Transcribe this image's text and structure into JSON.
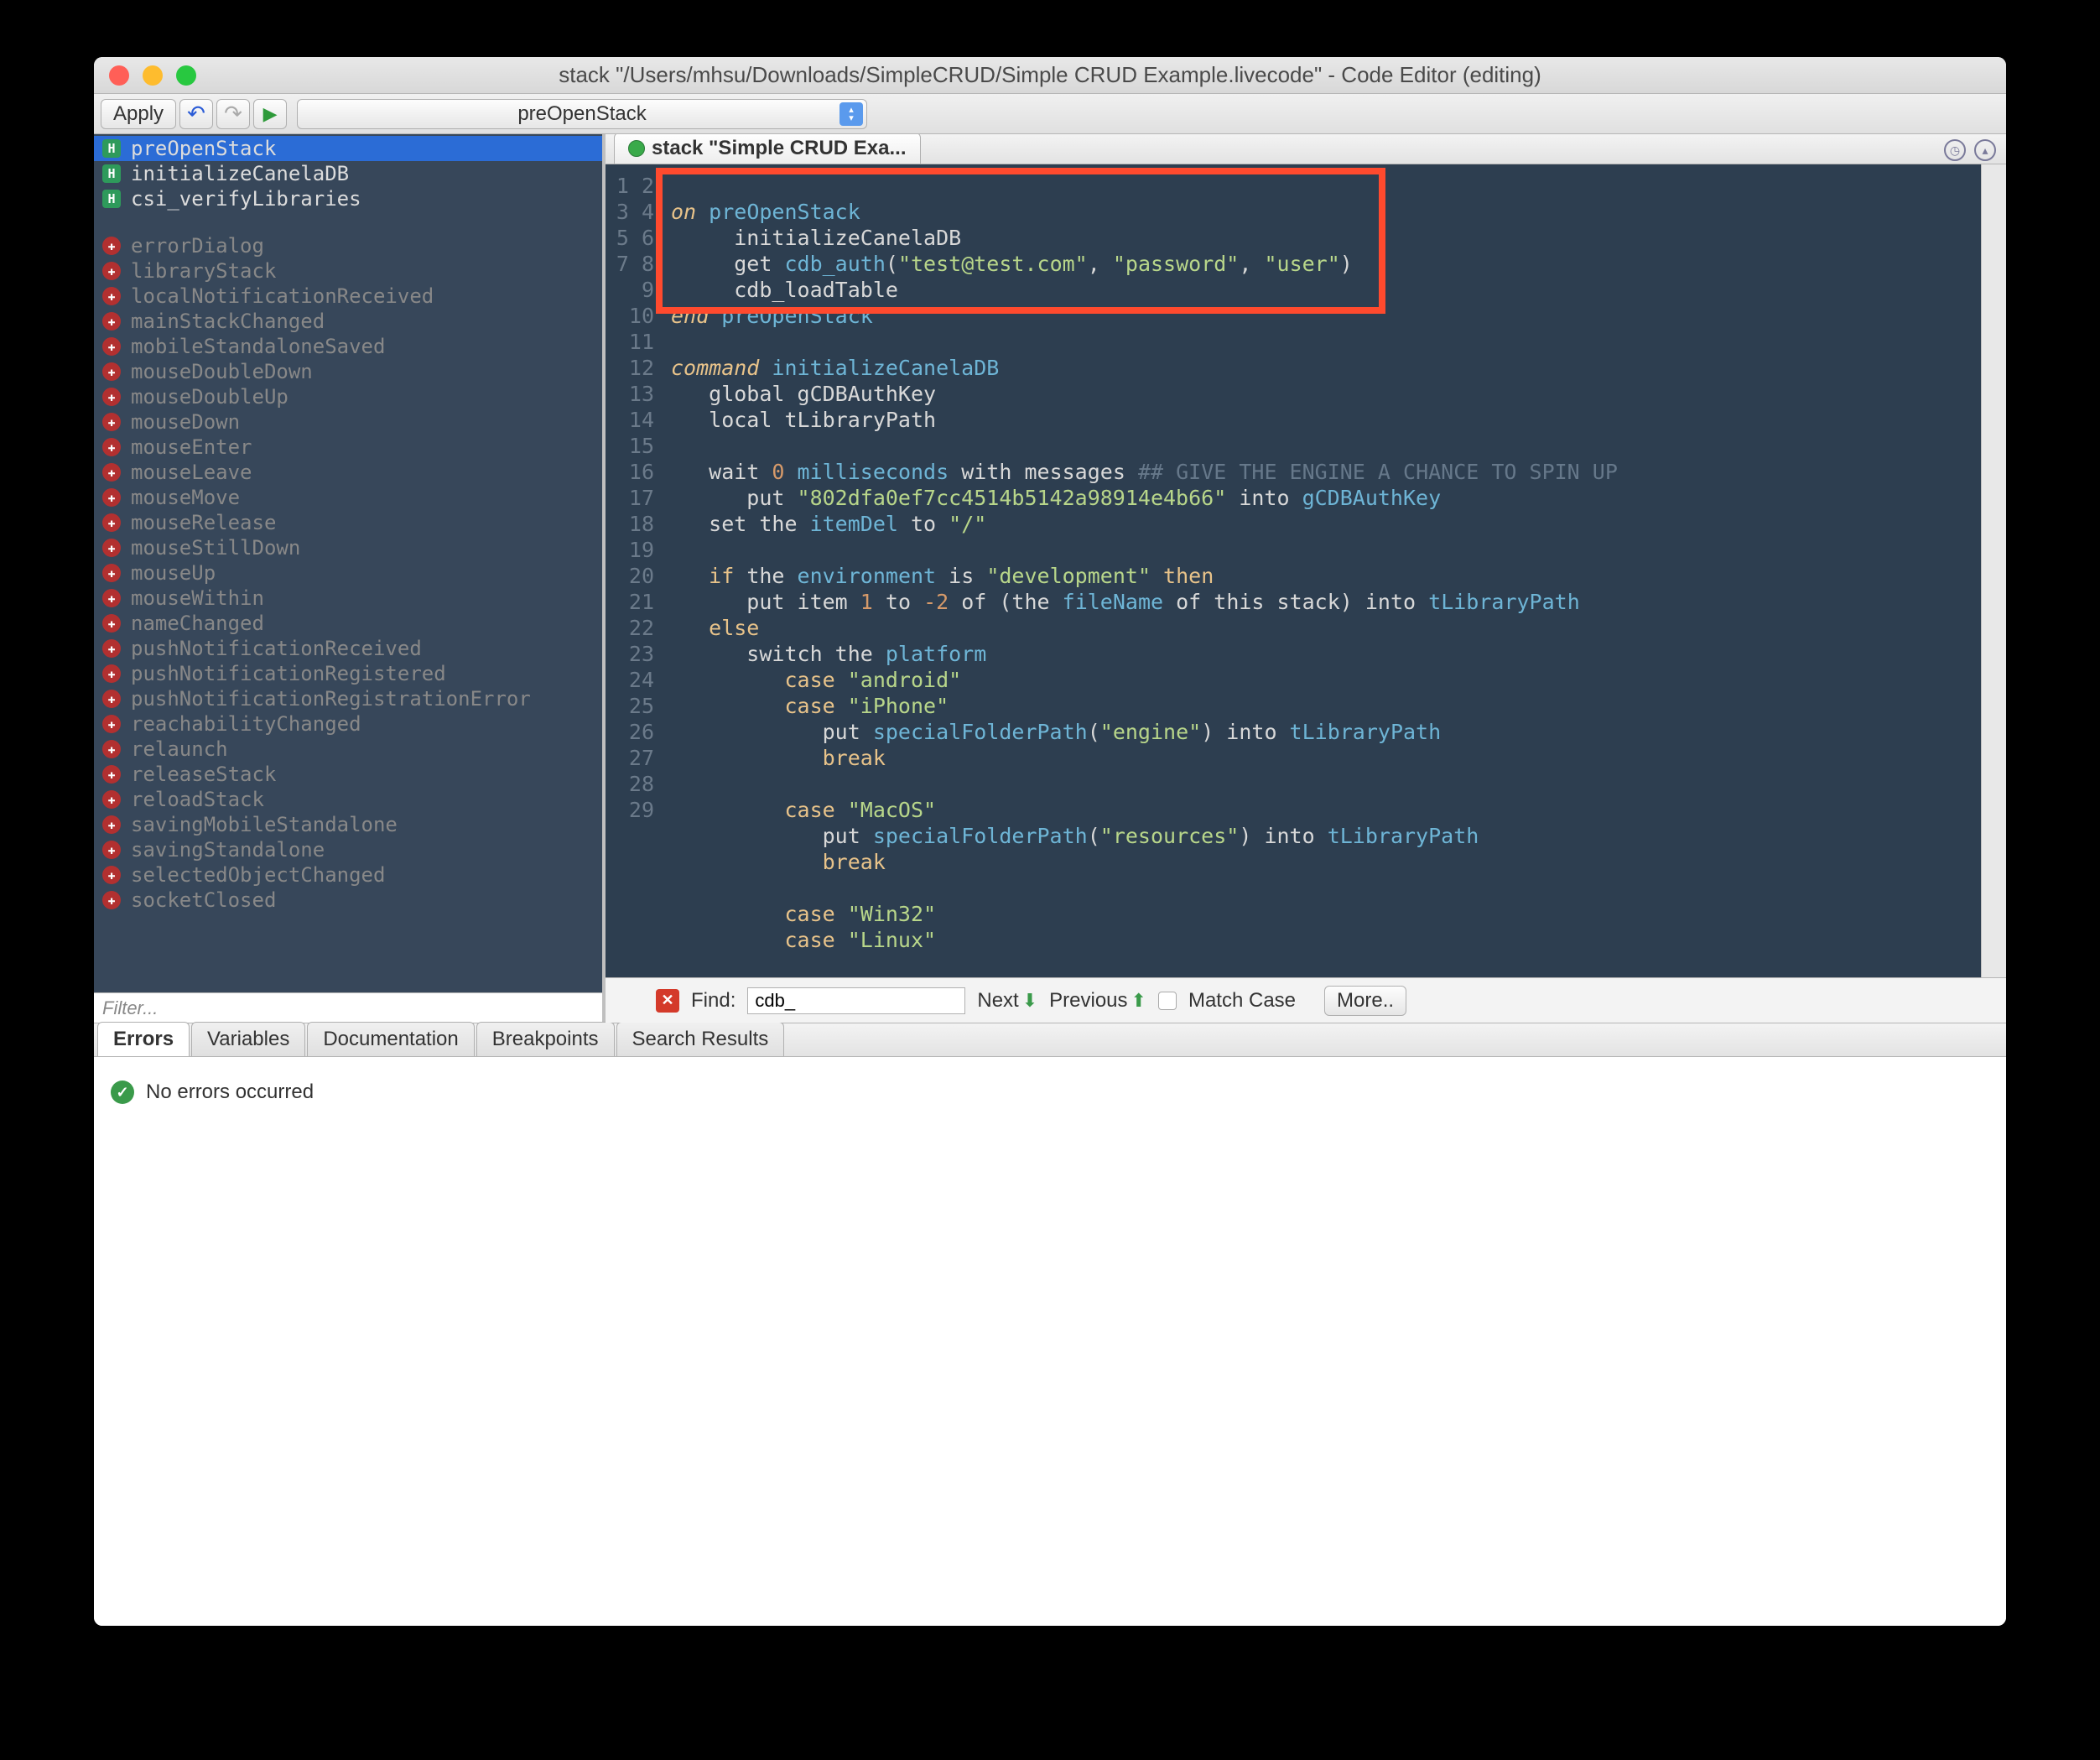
{
  "window": {
    "title": "stack \"/Users/mhsu/Downloads/SimpleCRUD/Simple CRUD Example.livecode\" - Code Editor (editing)"
  },
  "toolbar": {
    "apply_label": "Apply",
    "dropdown_value": "preOpenStack"
  },
  "tabs": {
    "editor_tab": "stack \"Simple CRUD Exa..."
  },
  "handlers": {
    "defined": [
      {
        "name": "preOpenStack"
      },
      {
        "name": "initializeCanelaDB"
      },
      {
        "name": "csi_verifyLibraries"
      }
    ],
    "available": [
      "errorDialog",
      "libraryStack",
      "localNotificationReceived",
      "mainStackChanged",
      "mobileStandaloneSaved",
      "mouseDoubleDown",
      "mouseDoubleUp",
      "mouseDown",
      "mouseEnter",
      "mouseLeave",
      "mouseMove",
      "mouseRelease",
      "mouseStillDown",
      "mouseUp",
      "mouseWithin",
      "nameChanged",
      "pushNotificationReceived",
      "pushNotificationRegistered",
      "pushNotificationRegistrationError",
      "reachabilityChanged",
      "relaunch",
      "releaseStack",
      "reloadStack",
      "savingMobileStandalone",
      "savingStandalone",
      "selectedObjectChanged",
      "socketClosed"
    ]
  },
  "filter": {
    "placeholder": "Filter..."
  },
  "code": {
    "line_count": 29,
    "lines": {
      "l1a": "on",
      "l1b": " preOpenStack",
      "l2": "     initializeCanelaDB",
      "l3a": "     get ",
      "l3b": "cdb_auth",
      "l3c": "(",
      "l3d": "\"test@test.com\"",
      "l3e": ", ",
      "l3f": "\"password\"",
      "l3g": ", ",
      "l3h": "\"user\"",
      "l3i": ")",
      "l4": "     cdb_loadTable",
      "l5a": "end",
      "l5b": " preOpenStack",
      "l7a": "command",
      "l7b": " initializeCanelaDB",
      "l8": "   global gCDBAuthKey",
      "l9": "   local tLibraryPath",
      "l11a": "   wait ",
      "l11b": "0",
      "l11c": " milliseconds",
      "l11d": " with messages ",
      "l11e": "## GIVE THE ENGINE A CHANCE TO SPIN UP",
      "l12a": "      put ",
      "l12b": "\"802dfa0ef7cc4514b5142a98914e4b66\"",
      "l12c": " into ",
      "l12d": "gCDBAuthKey",
      "l13a": "   set the ",
      "l13b": "itemDel",
      "l13c": " to ",
      "l13d": "\"/\"",
      "l15a": "   if",
      "l15b": " the ",
      "l15c": "environment",
      "l15d": " is ",
      "l15e": "\"development\"",
      "l15f": " then",
      "l16a": "      put item ",
      "l16b": "1",
      "l16c": " to ",
      "l16d": "-2",
      "l16e": " of (the ",
      "l16f": "fileName",
      "l16g": " of this stack) into ",
      "l16h": "tLibraryPath",
      "l17": "   else",
      "l18a": "      switch the ",
      "l18b": "platform",
      "l19a": "         case ",
      "l19b": "\"android\"",
      "l20a": "         case ",
      "l20b": "\"iPhone\"",
      "l21a": "            put ",
      "l21b": "specialFolderPath",
      "l21c": "(",
      "l21d": "\"engine\"",
      "l21e": ") into ",
      "l21f": "tLibraryPath",
      "l22": "            break",
      "l24a": "         case ",
      "l24b": "\"MacOS\"",
      "l25a": "            put ",
      "l25b": "specialFolderPath",
      "l25c": "(",
      "l25d": "\"resources\"",
      "l25e": ") into ",
      "l25f": "tLibraryPath",
      "l26": "            break",
      "l28a": "         case ",
      "l28b": "\"Win32\"",
      "l29a": "         case ",
      "l29b": "\"Linux\""
    }
  },
  "find": {
    "label": "Find:",
    "value": "cdb_",
    "next": "Next",
    "previous": "Previous",
    "match_case": "Match Case",
    "more": "More.."
  },
  "bottom_tabs": [
    "Errors",
    "Variables",
    "Documentation",
    "Breakpoints",
    "Search Results"
  ],
  "status": {
    "message": "No errors occurred"
  }
}
